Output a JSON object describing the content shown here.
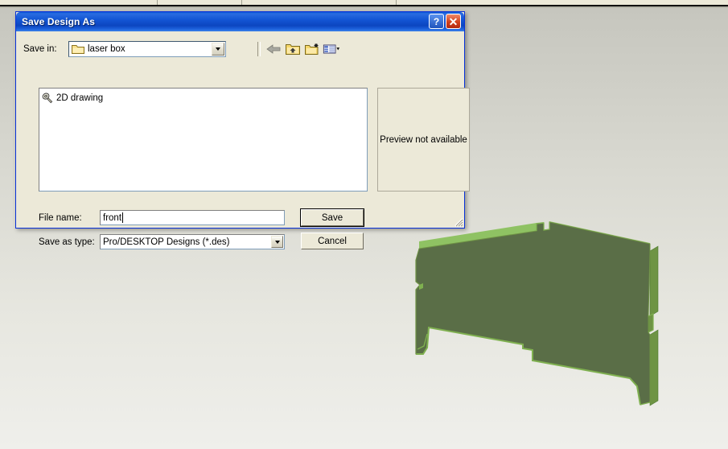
{
  "app": {
    "background_top_color": "#ece9d8",
    "viewport_bg_top": "#c8c8c0",
    "viewport_bg_bottom": "#eeeeea"
  },
  "dialog": {
    "title": "Save Design As",
    "titlebar_color": "#0a56d6",
    "help_button_label": "?",
    "close_button_label": "✕",
    "save_in": {
      "label": "Save in:",
      "value": "laser box",
      "icon": "folder-icon"
    },
    "toolbar": {
      "back_icon": "back-arrow-icon",
      "up_icon": "up-one-level-icon",
      "new_folder_icon": "new-folder-icon",
      "views_icon": "views-menu-icon"
    },
    "file_list": {
      "items": [
        {
          "name": "2D drawing",
          "icon": "drawing-file-icon"
        }
      ]
    },
    "preview": {
      "text": "Preview not available"
    },
    "file_name": {
      "label": "File name:",
      "value": "front",
      "placeholder": ""
    },
    "save_as_type": {
      "label": "Save as type:",
      "value": "Pro/DESKTOP Designs (*.des)",
      "options": [
        "Pro/DESKTOP Designs (*.des)"
      ]
    },
    "buttons": {
      "save": "Save",
      "cancel": "Cancel"
    }
  },
  "model": {
    "name": "laser-box-front-panel",
    "face_color": "#5a6e47",
    "edge_color": "#79ab4d",
    "edge_highlight": "#8fc263",
    "side_color": "#6e9444"
  }
}
